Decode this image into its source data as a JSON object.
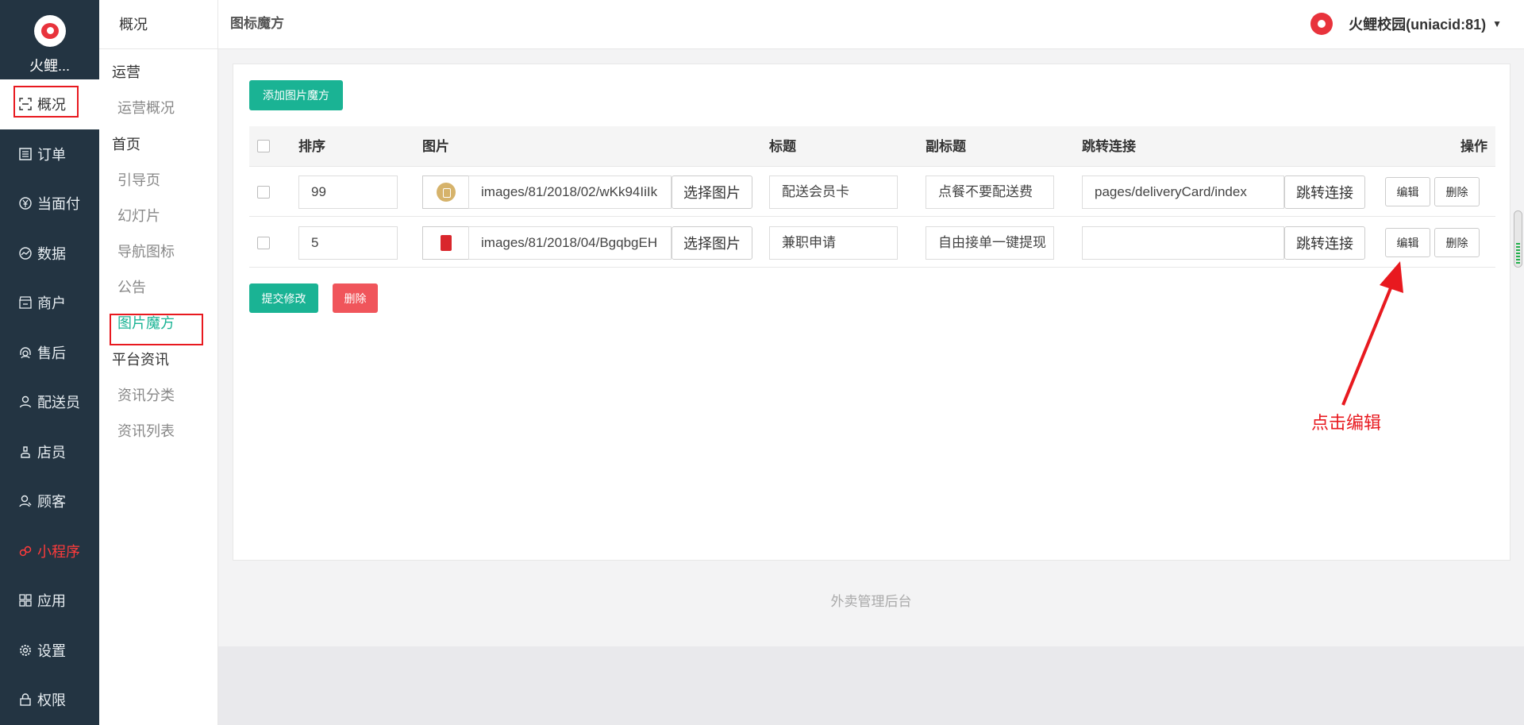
{
  "sidebar": {
    "brand_name": "火鲤...",
    "items": [
      {
        "label": "概况",
        "icon": "dashboard-icon"
      },
      {
        "label": "订单",
        "icon": "order-list-icon"
      },
      {
        "label": "当面付",
        "icon": "yen-icon"
      },
      {
        "label": "数据",
        "icon": "chart-line-icon"
      },
      {
        "label": "商户",
        "icon": "store-icon"
      },
      {
        "label": "售后",
        "icon": "headset-icon"
      },
      {
        "label": "配送员",
        "icon": "user-icon"
      },
      {
        "label": "店员",
        "icon": "clerk-icon"
      },
      {
        "label": "顾客",
        "icon": "customer-icon"
      },
      {
        "label": "小程序",
        "icon": "miniprogram-icon"
      },
      {
        "label": "应用",
        "icon": "apps-icon"
      },
      {
        "label": "设置",
        "icon": "gear-icon"
      },
      {
        "label": "权限",
        "icon": "lock-icon"
      }
    ]
  },
  "subnav": {
    "header": "概况",
    "group_ops": "运营",
    "ops_overview": "运营概况",
    "group_home": "首页",
    "guide": "引导页",
    "slides": "幻灯片",
    "nav_icons": "导航图标",
    "notice": "公告",
    "picture_cube": "图片魔方",
    "group_news": "平台资讯",
    "news_category": "资讯分类",
    "news_list": "资讯列表"
  },
  "header": {
    "title": "图标魔方",
    "account": "火鲤校园(uniacid:81)",
    "caret": "▼"
  },
  "main": {
    "add_button": "添加图片魔方",
    "columns": {
      "order": "排序",
      "image": "图片",
      "title": "标题",
      "subtitle": "副标题",
      "link": "跳转连接",
      "actions": "操作"
    },
    "rows": [
      {
        "order": "99",
        "image_path": "images/81/2018/02/wKk94IiIk",
        "select_image": "选择图片",
        "title": "配送会员卡",
        "subtitle": "点餐不要配送费",
        "link": "pages/deliveryCard/index",
        "link_button": "跳转连接",
        "edit": "编辑",
        "delete": "删除"
      },
      {
        "order": "5",
        "image_path": "images/81/2018/04/BgqbgEH",
        "select_image": "选择图片",
        "title": "兼职申请",
        "subtitle": "自由接单一键提现",
        "link": "",
        "link_button": "跳转连接",
        "edit": "编辑",
        "delete": "删除"
      }
    ],
    "submit_button": "提交修改",
    "delete_button": "删除"
  },
  "footer": {
    "text": "外卖管理后台"
  },
  "annotation": {
    "text": "点击编辑",
    "color": "#e8191f"
  },
  "colors": {
    "sidebar_bg": "#233442",
    "accent_green": "#1ab394",
    "danger_red": "#f0555b"
  }
}
